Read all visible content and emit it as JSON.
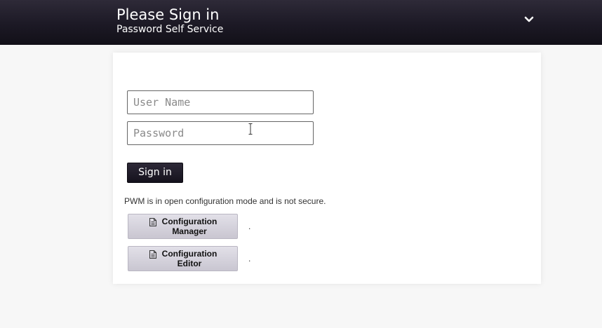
{
  "header": {
    "title": "Please Sign in",
    "subtitle": "Password Self Service",
    "menu_icon": "chevron-down-icon"
  },
  "login": {
    "username_placeholder": "User Name",
    "username_value": "",
    "password_placeholder": "Password",
    "password_value": "",
    "signin_label": "Sign in"
  },
  "config": {
    "warning": "PWM is in open configuration mode and is not secure.",
    "manager": {
      "line1": "Configuration",
      "line2": "Manager",
      "note": ".",
      "icon": "document-icon"
    },
    "editor": {
      "line1": "Configuration",
      "line2": "Editor",
      "note": ".",
      "icon": "document-icon"
    }
  },
  "colors": {
    "header_bg": "#1c1925",
    "page_bg": "#f7f7f7",
    "button_dark": "#15121d",
    "button_light": "#d4d1dc"
  }
}
